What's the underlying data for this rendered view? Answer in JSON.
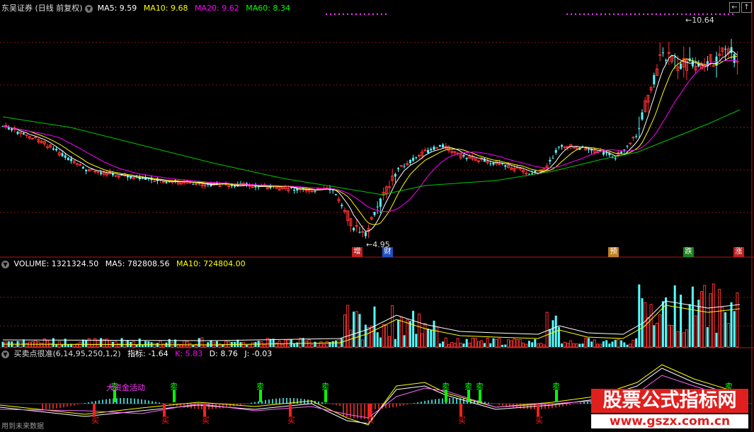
{
  "main_panel": {
    "title": "东吴证券 (日线 前复权)",
    "indicators": [
      {
        "label": "MA5: 9.59",
        "color": "#ffffff"
      },
      {
        "label": "MA10: 9.68",
        "color": "#ffff00"
      },
      {
        "label": "MA20: 9.62",
        "color": "#ff00ff"
      },
      {
        "label": "MA60: 8.34",
        "color": "#00ff00"
      }
    ],
    "high_marker": "10.64",
    "low_marker": "4.95",
    "events": [
      {
        "label": "增",
        "bg": "#c02020"
      },
      {
        "label": "财",
        "bg": "#2050c0"
      },
      {
        "label": "预",
        "bg": "#c08020"
      },
      {
        "label": "跌",
        "bg": "#208020"
      },
      {
        "label": "涨",
        "bg": "#c02020"
      }
    ]
  },
  "volume_panel": {
    "indicators": [
      {
        "label": "VOLUME: 1321324.50",
        "color": "#ffffff"
      },
      {
        "label": "MA5: 782808.56",
        "color": "#ffffff"
      },
      {
        "label": "MA10: 724804.00",
        "color": "#ffff00"
      }
    ]
  },
  "indicator_panel": {
    "title": "买卖点很准(6,14,95,250,1,2)",
    "indicators": [
      {
        "label": "指标: -1.64",
        "color": "#ffffff"
      },
      {
        "label": "K: 5.83",
        "color": "#ff00ff"
      },
      {
        "label": "D: 8.76",
        "color": "#ffffff"
      },
      {
        "label": "J: -0.03",
        "color": "#ffffff"
      }
    ],
    "big_money_label": "大资金活动",
    "sell_label": "卖",
    "buy_label": "买",
    "footer_text": "用到未来数据"
  },
  "watermark": {
    "line1": "股票公式指标网",
    "line2": "www.gszx.com.cn"
  },
  "window_buttons": [
    "←",
    "↑"
  ],
  "colors": {
    "up": "#ff3232",
    "down": "#54ffff",
    "ma5": "#ffffff",
    "ma10": "#ffff00",
    "ma20": "#ff00ff",
    "ma60": "#00c800",
    "grid": "#8a1010"
  }
}
